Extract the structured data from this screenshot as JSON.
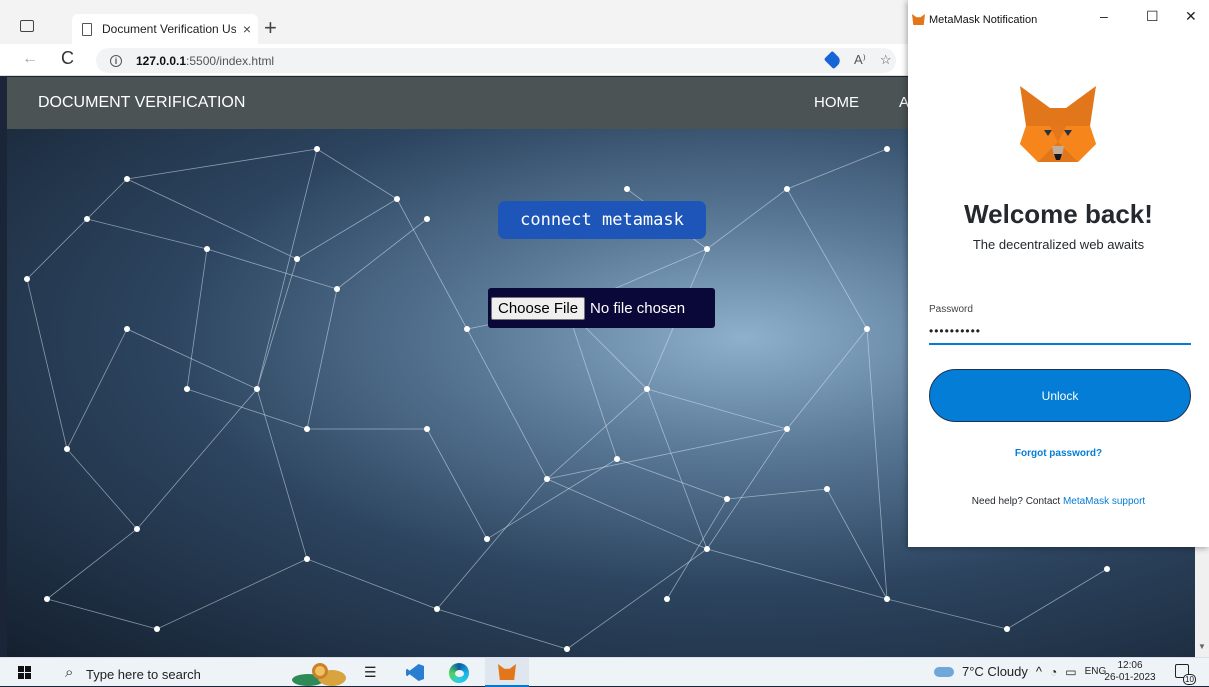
{
  "browser": {
    "tab_title": "Document Verification Using Blo",
    "tab_close": "×",
    "new_tab": "+",
    "back": "←",
    "refresh": "C",
    "url_host": "127.0.0.1",
    "url_path": ":5500/index.html",
    "info": "i",
    "read_aloud": "A⁾",
    "favorite": "☆"
  },
  "page": {
    "brand": "DOCUMENT VERIFICATION",
    "nav_home": "HOME",
    "nav_partial": "A",
    "connect_label": "connect metamask",
    "file_button": "Choose File",
    "file_status": "No file chosen"
  },
  "metamask": {
    "window_title": "MetaMask Notification",
    "minimize": "–",
    "maximize": "☐",
    "close": "✕",
    "welcome": "Welcome back!",
    "subtitle": "The decentralized web awaits",
    "password_label": "Password",
    "password_value": "••••••••••",
    "unlock_label": "Unlock",
    "forgot": "Forgot password?",
    "help_text": "Need help? Contact ",
    "help_link": "MetaMask support",
    "accent": "#037dd6"
  },
  "taskbar": {
    "search_placeholder": "Type here to search",
    "weather": "7°C Cloudy",
    "tray_up": "^",
    "language": "ENG",
    "time": "12:06",
    "date": "26-01-2023",
    "notification_count": "10"
  }
}
